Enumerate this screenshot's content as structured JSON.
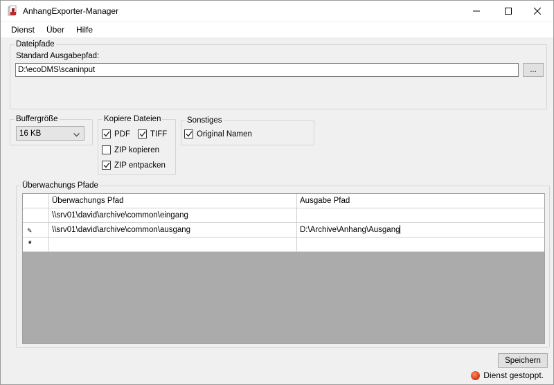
{
  "window": {
    "title": "AnhangExporter-Manager"
  },
  "menu": {
    "items": [
      "Dienst",
      "Über",
      "Hilfe"
    ]
  },
  "dateipfade": {
    "legend": "Dateipfade",
    "label": "Standard Ausgabepfad:",
    "value": "D:\\ecoDMS\\scaninput",
    "browse_label": "..."
  },
  "buffer": {
    "legend": "Buffergröße",
    "selected": "16 KB"
  },
  "kopiere": {
    "legend": "Kopiere Dateien",
    "pdf": {
      "label": "PDF",
      "checked": true
    },
    "tiff": {
      "label": "TIFF",
      "checked": true
    },
    "zip_kopieren": {
      "label": "ZIP kopieren",
      "checked": false
    },
    "zip_entpacken": {
      "label": "ZIP entpacken",
      "checked": true
    }
  },
  "sonstiges": {
    "legend": "Sonstiges",
    "original_namen": {
      "label": "Original Namen",
      "checked": true
    }
  },
  "ueberwachung": {
    "legend": "Überwachungs Pfade",
    "columns": [
      "Überwachungs Pfad",
      "Ausgabe Pfad"
    ],
    "rows": [
      {
        "marker": "",
        "pfad": "\\\\srv01\\david\\archive\\common\\eingang",
        "ausgabe": ""
      },
      {
        "marker": "✎",
        "pfad": "\\\\srv01\\david\\archive\\common\\ausgang",
        "ausgabe": "D:\\Archive\\Anhang\\Ausgang"
      },
      {
        "marker": "*",
        "pfad": "",
        "ausgabe": ""
      }
    ]
  },
  "footer": {
    "save_label": "Speichern",
    "status_text": "Dienst gestoppt.",
    "status_color": "#d8401a"
  }
}
